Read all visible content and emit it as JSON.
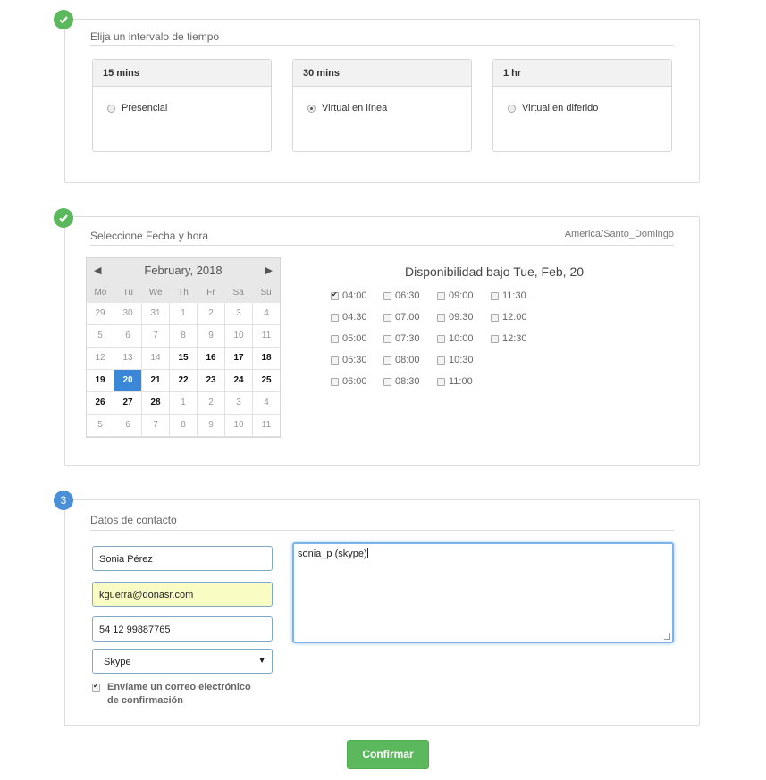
{
  "colors": {
    "success": "#5cb85c",
    "active": "#4a90d9",
    "selected_day": "#3a87d8",
    "autofill": "#fafdc3"
  },
  "step1": {
    "title": "Elija un intervalo de tiempo",
    "cards": [
      {
        "header": "15 mins",
        "option": "Presencial",
        "checked": false
      },
      {
        "header": "30 mins",
        "option": "Virtual en línea",
        "checked": true
      },
      {
        "header": "1 hr",
        "option": "Virtual en diferido",
        "checked": false
      }
    ]
  },
  "step2": {
    "title": "Seleccione Fecha y hora",
    "timezone": "America/Santo_Domingo",
    "calendar": {
      "prev": "◀",
      "next": "▶",
      "month_label": "February, 2018",
      "dow": [
        "Mo",
        "Tu",
        "We",
        "Th",
        "Fr",
        "Sa",
        "Su"
      ],
      "weeks": [
        [
          {
            "d": "29",
            "s": "out"
          },
          {
            "d": "30",
            "s": "out"
          },
          {
            "d": "31",
            "s": "out"
          },
          {
            "d": "1",
            "s": "out"
          },
          {
            "d": "2",
            "s": "out"
          },
          {
            "d": "3",
            "s": "out"
          },
          {
            "d": "4",
            "s": "out"
          }
        ],
        [
          {
            "d": "5",
            "s": "out"
          },
          {
            "d": "6",
            "s": "out"
          },
          {
            "d": "7",
            "s": "out"
          },
          {
            "d": "8",
            "s": "out"
          },
          {
            "d": "9",
            "s": "out"
          },
          {
            "d": "10",
            "s": "out"
          },
          {
            "d": "11",
            "s": "out"
          }
        ],
        [
          {
            "d": "12",
            "s": "out"
          },
          {
            "d": "13",
            "s": "out"
          },
          {
            "d": "14",
            "s": "out"
          },
          {
            "d": "15",
            "s": "avail"
          },
          {
            "d": "16",
            "s": "avail"
          },
          {
            "d": "17",
            "s": "avail"
          },
          {
            "d": "18",
            "s": "avail"
          }
        ],
        [
          {
            "d": "19",
            "s": "avail"
          },
          {
            "d": "20",
            "s": "sel"
          },
          {
            "d": "21",
            "s": "avail"
          },
          {
            "d": "22",
            "s": "avail"
          },
          {
            "d": "23",
            "s": "avail"
          },
          {
            "d": "24",
            "s": "avail"
          },
          {
            "d": "25",
            "s": "avail"
          }
        ],
        [
          {
            "d": "26",
            "s": "avail"
          },
          {
            "d": "27",
            "s": "avail"
          },
          {
            "d": "28",
            "s": "avail"
          },
          {
            "d": "1",
            "s": "out"
          },
          {
            "d": "2",
            "s": "out"
          },
          {
            "d": "3",
            "s": "out"
          },
          {
            "d": "4",
            "s": "out"
          }
        ],
        [
          {
            "d": "5",
            "s": "out"
          },
          {
            "d": "6",
            "s": "out"
          },
          {
            "d": "7",
            "s": "out"
          },
          {
            "d": "8",
            "s": "out"
          },
          {
            "d": "9",
            "s": "out"
          },
          {
            "d": "10",
            "s": "out"
          },
          {
            "d": "11",
            "s": "out"
          }
        ]
      ]
    },
    "availability_title": "Disponibilidad bajo Tue, Feb, 20",
    "slot_columns": [
      [
        {
          "t": "04:00",
          "checked": true
        },
        {
          "t": "04:30"
        },
        {
          "t": "05:00"
        },
        {
          "t": "05:30"
        },
        {
          "t": "06:00"
        }
      ],
      [
        {
          "t": "06:30"
        },
        {
          "t": "07:00"
        },
        {
          "t": "07:30"
        },
        {
          "t": "08:00"
        },
        {
          "t": "08:30"
        }
      ],
      [
        {
          "t": "09:00"
        },
        {
          "t": "09:30"
        },
        {
          "t": "10:00"
        },
        {
          "t": "10:30"
        },
        {
          "t": "11:00"
        }
      ],
      [
        {
          "t": "11:30"
        },
        {
          "t": "12:00"
        },
        {
          "t": "12:30"
        }
      ]
    ]
  },
  "step3": {
    "badge": "3",
    "title": "Datos de contacto",
    "name": "Sonia Pérez",
    "email": "kguerra@donasr.com",
    "phone": "54 12 99887765",
    "contact_method": "Skype",
    "notes": "sonia_p (skype)",
    "confirm_email_label": "Envíame un correo electrónico de confirmación",
    "confirm_email_checked": true
  },
  "confirm_button": "Confirmar"
}
